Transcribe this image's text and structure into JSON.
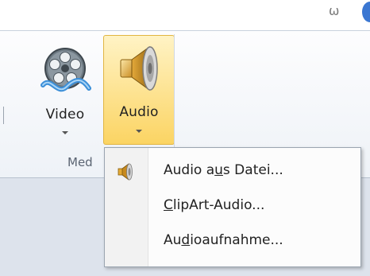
{
  "titlebar": {
    "glyph": "ω"
  },
  "ribbon": {
    "group_label": "Med",
    "buttons": {
      "video": {
        "label": "Video",
        "icon": "film-reel-icon"
      },
      "audio": {
        "label": "Audio",
        "icon": "speaker-icon"
      }
    }
  },
  "menu": {
    "items": [
      {
        "parts": [
          "Audio a",
          "u",
          "s Datei..."
        ],
        "icon": "speaker-icon"
      },
      {
        "parts": [
          "",
          "C",
          "lipArt-Audio..."
        ]
      },
      {
        "parts": [
          "Au",
          "d",
          "ioaufnahme..."
        ]
      }
    ]
  },
  "colors": {
    "active_button_top": "#fff3c5",
    "active_button_bottom": "#fbd463",
    "active_button_border": "#e1b542",
    "accent_blue": "#3b77d2"
  }
}
